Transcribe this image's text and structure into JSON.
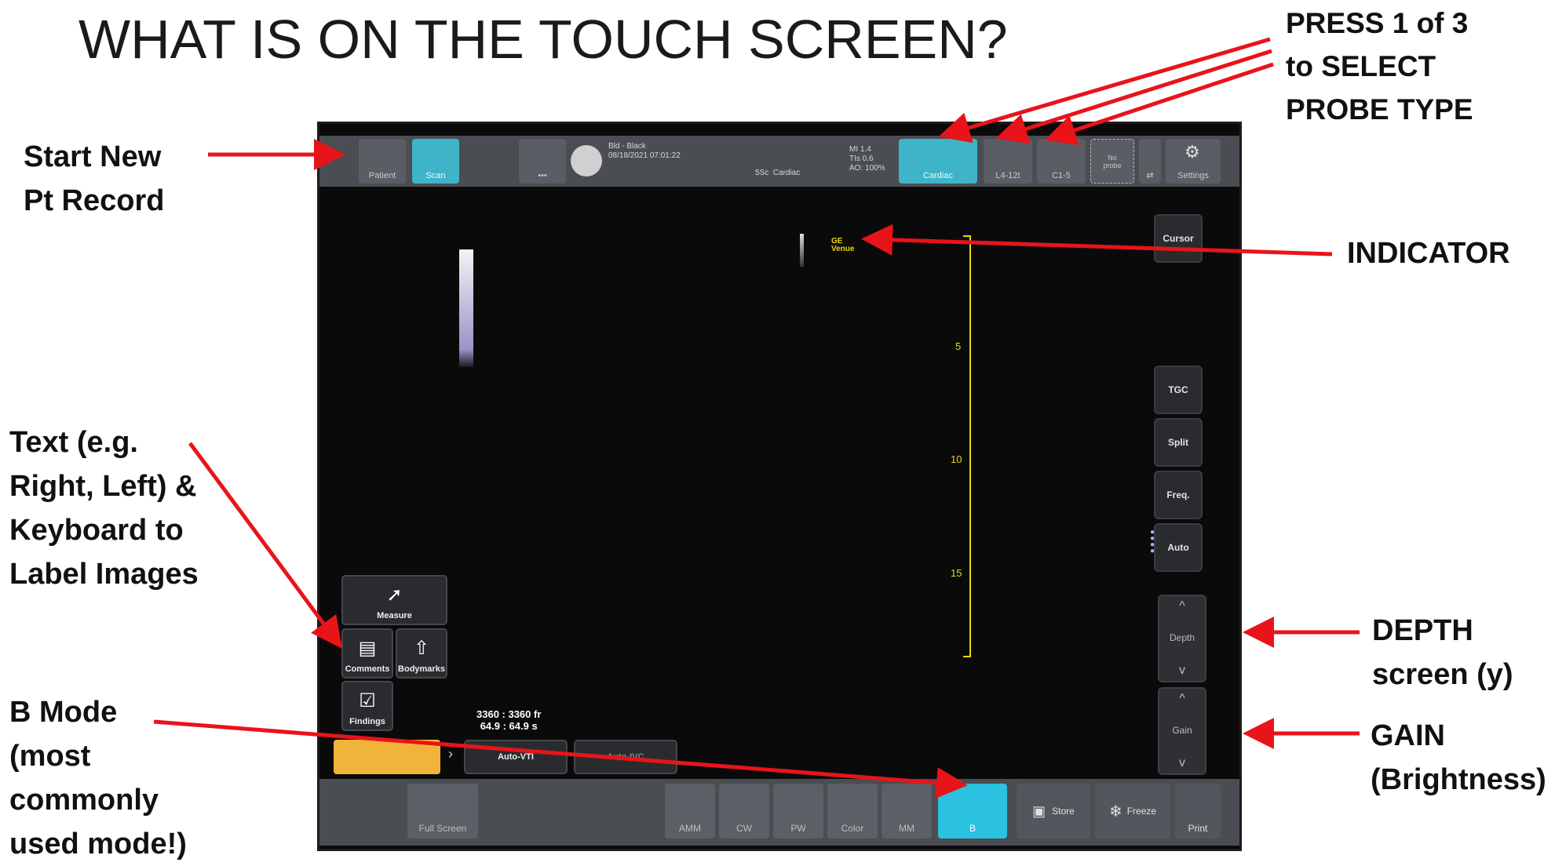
{
  "slide_title": "WHAT IS ON THE TOUCH SCREEN?",
  "annotations": {
    "start_new": [
      "Start New",
      "Pt Record"
    ],
    "press_probe": [
      "PRESS 1 of 3",
      "to SELECT",
      "PROBE TYPE"
    ],
    "indicator": "INDICATOR",
    "text_keyboard": [
      "Text (e.g.",
      "Right, Left) &",
      "Keyboard to",
      "Label Images"
    ],
    "b_mode": [
      "B Mode",
      "(most",
      "commonly",
      "used mode!)"
    ],
    "depth": [
      "DEPTH",
      "screen (y)"
    ],
    "gain": [
      "GAIN",
      "(Brightness)"
    ]
  },
  "topbar": {
    "patient_label": "Patient",
    "scan_label": "Scan",
    "more_label": "•••",
    "patient_info": "Bld - Black\n08/18/2021 07:01:22",
    "preset": "5Sc  Cardiac",
    "mi_info": "MI 1.4\nTIs 0.6\nAO: 100%",
    "probes": [
      "Cardiac",
      "L4-12t",
      "C1-5"
    ],
    "no_probe": "No\nprobe",
    "settings_label": "Settings"
  },
  "image_area": {
    "ge_logo": "GE\nVenue",
    "depth_ticks": [
      "5",
      "10",
      "15"
    ],
    "frame_counter": "3360 : 3360 fr\n64.9 : 64.9 s"
  },
  "right_panel": [
    "Cursor",
    "TGC",
    "Split",
    "Freq.",
    "Auto"
  ],
  "steppers": {
    "depth": "Depth",
    "gain": "Gain",
    "up": "^",
    "down": "v"
  },
  "tools": {
    "measure": "Measure",
    "comments": "Comments",
    "bodymarks": "Bodymarks",
    "findings": "Findings"
  },
  "auto_tools": [
    "Auto-VTI",
    "Auto-IVC"
  ],
  "bottombar": {
    "full_screen": "Full Screen",
    "modes": [
      "AMM",
      "CW",
      "PW",
      "Color",
      "MM",
      "B"
    ],
    "store": "Store",
    "freeze": "Freeze",
    "print": "Print"
  },
  "colors": {
    "arrow": "#e8141a",
    "teal": "#2bc1e0",
    "depth_scale": "#e8d80c"
  }
}
